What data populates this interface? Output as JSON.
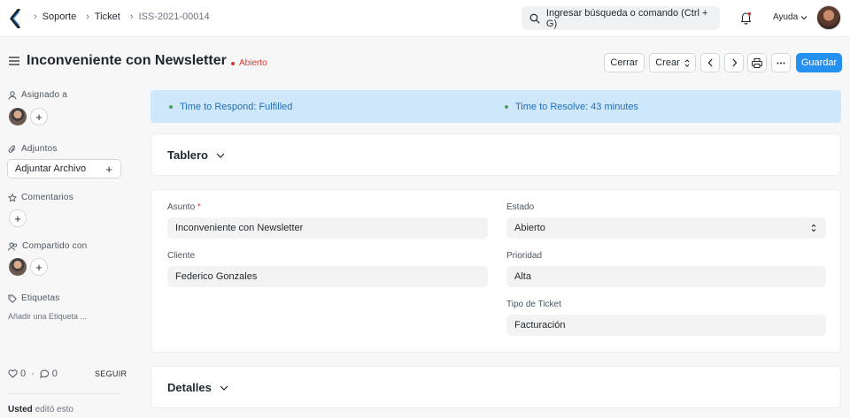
{
  "navbar": {
    "breadcrumbs": [
      "Soporte",
      "Ticket",
      "ISS-2021-00014"
    ],
    "search_placeholder": "Ingresar búsqueda o comando (Ctrl + G)",
    "help_label": "Ayuda"
  },
  "page": {
    "title": "Inconveniente con Newsletter",
    "status": "Abierto",
    "status_color": "#e03636"
  },
  "actions": {
    "close": "Cerrar",
    "create": "Crear",
    "save": "Guardar"
  },
  "sidebar": {
    "assigned_label": "Asignado a",
    "attachments_label": "Adjuntos",
    "attach_button": "Adjuntar Archivo",
    "comments_label": "Comentarios",
    "shared_label": "Compartido con",
    "tags_label": "Etiquetas",
    "add_tag": "Añadir una Etiqueta ...",
    "likes_count": "0",
    "comments_count": "0",
    "follow": "SEGUIR",
    "edited_user": "Usted",
    "edited_text": "editó esto"
  },
  "banner": {
    "respond": "Time to Respond: Fulfilled",
    "resolve": "Time to Resolve: 43 minutes"
  },
  "sections": {
    "dashboard": "Tablero",
    "details": "Detalles"
  },
  "form": {
    "subject_label": "Asunto",
    "subject_required": "*",
    "subject_value": "Inconveniente con Newsletter",
    "customer_label": "Cliente",
    "customer_value": "Federico Gonzales",
    "status_label": "Estado",
    "status_value": "Abierto",
    "priority_label": "Prioridad",
    "priority_value": "Alta",
    "ticket_type_label": "Tipo de Ticket",
    "ticket_type_value": "Facturación"
  },
  "colors": {
    "primary": "#2490ef",
    "banner_bg": "#cfe7fa",
    "banner_text": "#1d6fb8"
  }
}
